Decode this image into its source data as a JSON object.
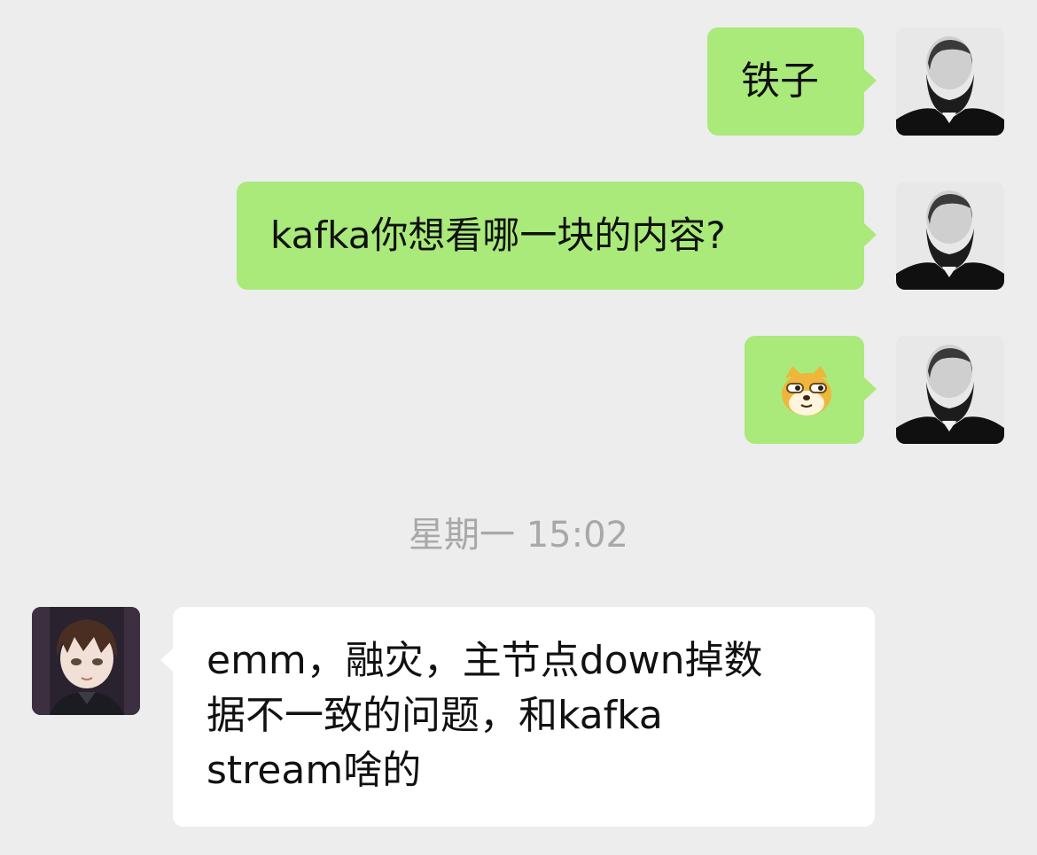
{
  "conversation": {
    "messages": [
      {
        "direction": "outgoing",
        "text": "铁子"
      },
      {
        "direction": "outgoing",
        "text": "kafka你想看哪一块的内容?"
      },
      {
        "direction": "outgoing",
        "sticker": "doge-sticker-icon"
      },
      {
        "direction": "incoming",
        "lines": [
          "emm，融灾，主节点down掉数",
          "据不一致的问题，和kafka",
          "stream啥的"
        ]
      }
    ],
    "timestamp": "星期一 15:02"
  },
  "colors": {
    "background": "#ededed",
    "outgoing_bubble": "#a9ea7a",
    "incoming_bubble": "#ffffff",
    "timestamp_text": "#a8a8a8"
  }
}
